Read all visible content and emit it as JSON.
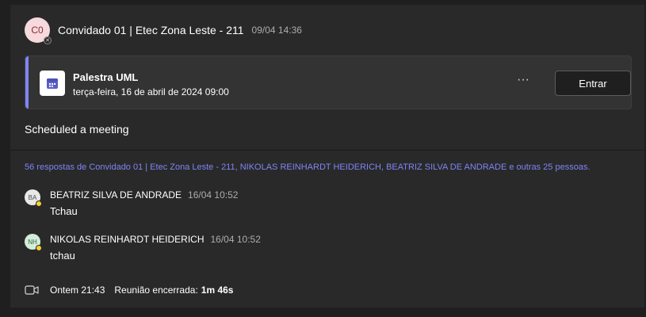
{
  "post": {
    "avatar_initials": "C0",
    "author": "Convidado 01 | Etec Zona Leste - 211",
    "timestamp": "09/04 14:36",
    "text": "Scheduled a meeting"
  },
  "meeting": {
    "title": "Palestra UML",
    "datetime": "terça-feira, 16 de abril de 2024 09:00",
    "more_label": "···",
    "join_label": "Entrar"
  },
  "replies": {
    "summary": "56 respostas de Convidado 01 | Etec Zona Leste - 211, NIKOLAS REINHARDT HEIDERICH, BEATRIZ SILVA DE ANDRADE e outras 25 pessoas.",
    "items": [
      {
        "initials": "BA",
        "author": "BEATRIZ SILVA DE ANDRADE",
        "time": "16/04 10:52",
        "text": "Tchau",
        "avatar_bg": "#e8e8e8",
        "avatar_fg": "#4a4a4a"
      },
      {
        "initials": "NH",
        "author": "NIKOLAS REINHARDT HEIDERICH",
        "time": "16/04 10:52",
        "text": "tchau",
        "avatar_bg": "#d4ecd9",
        "avatar_fg": "#2f6a3c"
      }
    ]
  },
  "activity": {
    "time": "Ontem 21:43",
    "ended_label": "Reunião encerrada:",
    "duration": "1m 46s"
  },
  "colors": {
    "accent": "#7f85f5",
    "presence_away": "#f8d22a"
  }
}
